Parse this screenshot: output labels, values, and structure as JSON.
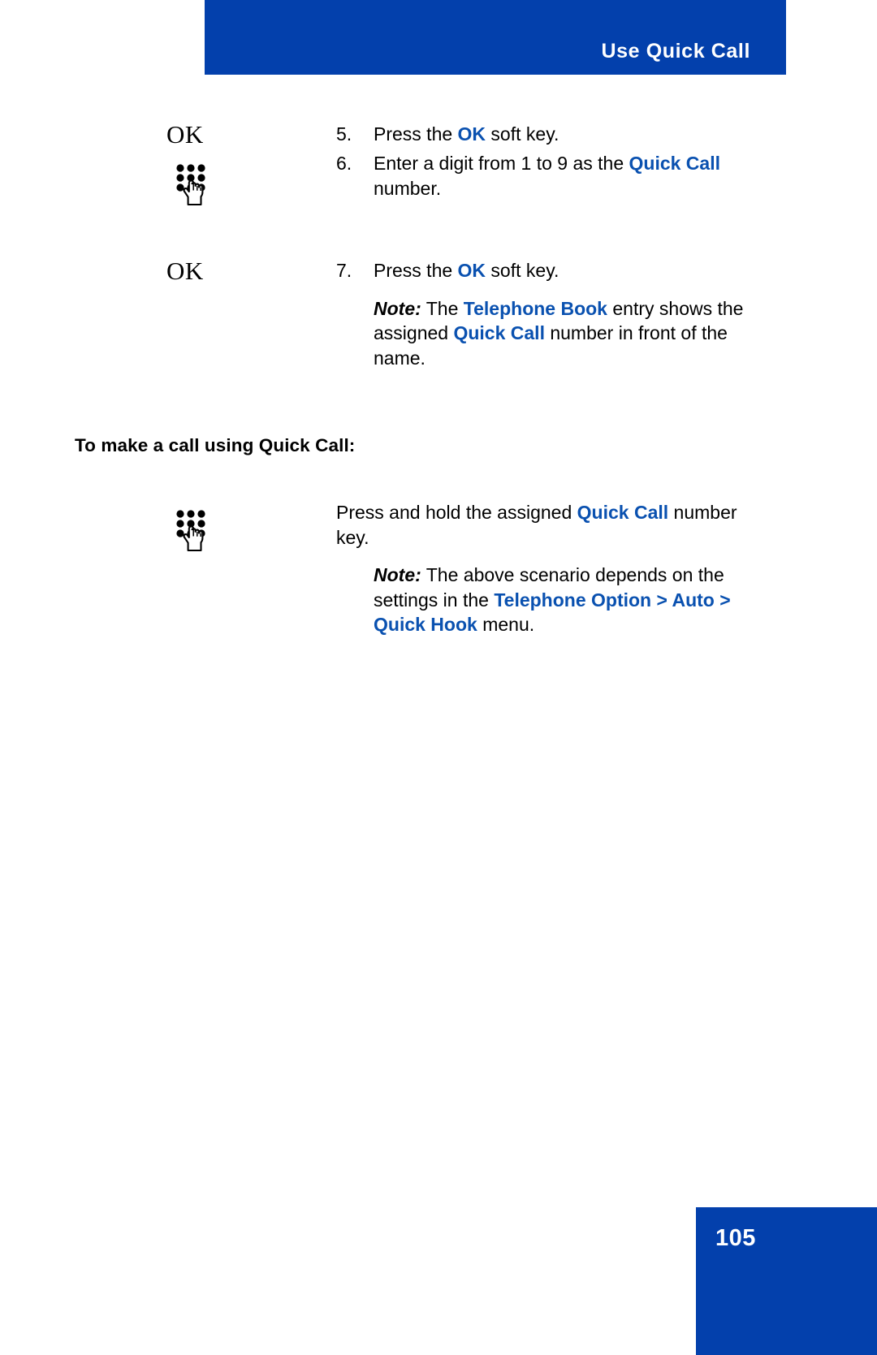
{
  "header": {
    "title": "Use Quick Call",
    "background_color": "#0340AC",
    "text_color": "#ffffff"
  },
  "accent_color": "#0A51B0",
  "icons": {
    "ok_soft_key": "OK",
    "keypad_label": "keypad-hand-icon"
  },
  "steps": [
    {
      "number": "5.",
      "icon": "OK",
      "icon_kind": "ok-text",
      "parts": [
        {
          "t": "Press the ",
          "s": "plain"
        },
        {
          "t": "OK",
          "s": "blue"
        },
        {
          "t": " soft key.",
          "s": "plain"
        }
      ]
    },
    {
      "number": "6.",
      "icon": "keypad-hand-icon",
      "icon_kind": "keypad",
      "parts": [
        {
          "t": "Enter a digit from 1 to 9 as the ",
          "s": "plain"
        },
        {
          "t": "Quick Call",
          "s": "blue"
        },
        {
          "t": " number.",
          "s": "plain"
        }
      ]
    },
    {
      "number": "7.",
      "icon": "OK",
      "icon_kind": "ok-text",
      "parts": [
        {
          "t": "Press the ",
          "s": "plain"
        },
        {
          "t": "OK",
          "s": "blue"
        },
        {
          "t": " soft key.",
          "s": "plain"
        }
      ],
      "note": {
        "label": "Note:",
        "parts": [
          {
            "t": " The ",
            "s": "plain"
          },
          {
            "t": "Telephone Book",
            "s": "blue"
          },
          {
            "t": " entry shows the assigned ",
            "s": "plain"
          },
          {
            "t": "Quick Call",
            "s": "blue"
          },
          {
            "t": " number in front of the name.",
            "s": "plain"
          }
        ]
      }
    }
  ],
  "section": {
    "heading": "To make a call using Quick Call:",
    "icon": "keypad-hand-icon",
    "body_parts": [
      {
        "t": "Press and hold the assigned ",
        "s": "plain"
      },
      {
        "t": "Quick Call",
        "s": "blue"
      },
      {
        "t": " number key.",
        "s": "plain"
      }
    ],
    "note": {
      "label": "Note:",
      "parts": [
        {
          "t": " The above scenario depends on the settings in the ",
          "s": "plain"
        },
        {
          "t": "Telephone Option > Auto > Quick Hook",
          "s": "blue"
        },
        {
          "t": " menu.",
          "s": "plain"
        }
      ]
    }
  },
  "footer": {
    "page_number": "105",
    "background_color": "#0340AC",
    "text_color": "#ffffff"
  }
}
